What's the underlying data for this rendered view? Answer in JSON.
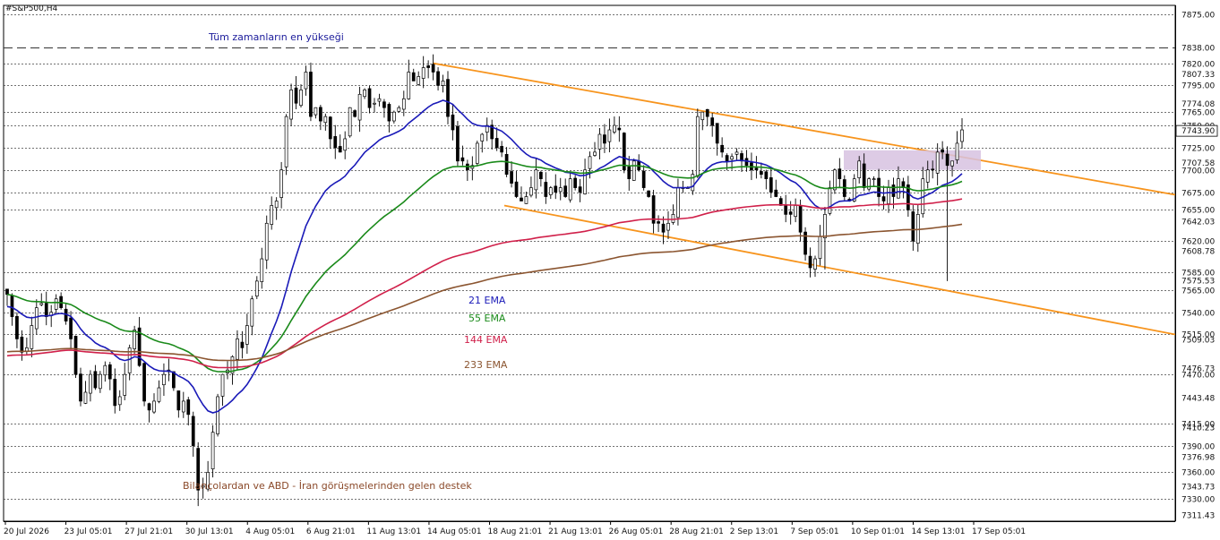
{
  "symbol_label": "#S&P500,H4",
  "chart_data": {
    "type": "candlestick",
    "symbol": "#S&P500,H4",
    "ylim": [
      7305,
      7885
    ],
    "price_levels": [
      7875,
      7838,
      7820,
      7795,
      7765,
      7750,
      7725,
      7700,
      7675,
      7655,
      7620,
      7585,
      7565,
      7540,
      7515,
      7470,
      7415,
      7390,
      7360,
      7330
    ],
    "y_ticks_minor": [
      7807.33,
      7774.08,
      7743.9,
      7707.58,
      7642.03,
      7608.78,
      7575.53,
      7509.03,
      7476.73,
      7443.48,
      7410.23,
      7376.98,
      7343.73,
      7311.43
    ],
    "current_price": "7743.90",
    "all_time_high": 7838,
    "x_ticks": [
      "20 Jul 2026",
      "23 Jul 05:01",
      "27 Jul 21:01",
      "30 Jul 13:01",
      "4 Aug 05:01",
      "6 Aug 21:01",
      "11 Aug 13:01",
      "14 Aug 05:01",
      "18 Aug 21:01",
      "21 Aug 13:01",
      "26 Aug 05:01",
      "28 Aug 21:01",
      "2 Sep 13:01",
      "7 Sep 05:01",
      "10 Sep 01:01",
      "14 Sep 13:01",
      "17 Sep 05:01"
    ],
    "closes": [
      7560,
      7535,
      7510,
      7495,
      7500,
      7525,
      7545,
      7550,
      7535,
      7540,
      7555,
      7545,
      7530,
      7510,
      7470,
      7440,
      7450,
      7470,
      7455,
      7470,
      7480,
      7465,
      7435,
      7445,
      7470,
      7500,
      7520,
      7480,
      7440,
      7430,
      7440,
      7455,
      7470,
      7475,
      7455,
      7430,
      7440,
      7425,
      7390,
      7340,
      7345,
      7360,
      7405,
      7445,
      7470,
      7475,
      7490,
      7510,
      7500,
      7525,
      7555,
      7575,
      7600,
      7640,
      7660,
      7665,
      7700,
      7760,
      7790,
      7775,
      7790,
      7810,
      7760,
      7770,
      7755,
      7760,
      7735,
      7725,
      7720,
      7735,
      7770,
      7760,
      7785,
      7790,
      7770,
      7775,
      7780,
      7770,
      7755,
      7765,
      7770,
      7780,
      7810,
      7800,
      7805,
      7815,
      7815,
      7810,
      7795,
      7800,
      7760,
      7745,
      7710,
      7710,
      7700,
      7705,
      7730,
      7740,
      7750,
      7735,
      7725,
      7720,
      7695,
      7685,
      7670,
      7665,
      7670,
      7680,
      7700,
      7690,
      7670,
      7680,
      7675,
      7680,
      7670,
      7690,
      7680,
      7675,
      7700,
      7715,
      7720,
      7740,
      7730,
      7745,
      7750,
      7745,
      7700,
      7690,
      7710,
      7700,
      7680,
      7670,
      7640,
      7640,
      7630,
      7640,
      7650,
      7680,
      7680,
      7680,
      7695,
      7760,
      7765,
      7760,
      7750,
      7730,
      7720,
      7710,
      7715,
      7720,
      7710,
      7705,
      7700,
      7700,
      7695,
      7690,
      7675,
      7670,
      7660,
      7650,
      7650,
      7660,
      7630,
      7605,
      7590,
      7600,
      7625,
      7650,
      7680,
      7700,
      7690,
      7670,
      7665,
      7690,
      7710,
      7680,
      7690,
      7690,
      7670,
      7665,
      7680,
      7670,
      7690,
      7680,
      7655,
      7620,
      7650,
      7690,
      7700,
      7700,
      7720,
      7720,
      7705,
      7710,
      7730,
      7745
    ],
    "series": [
      {
        "name": "21 EMA",
        "color": "#1a1ab8"
      },
      {
        "name": "55 EMA",
        "color": "#1a8a1a"
      },
      {
        "name": "144 EMA",
        "color": "#d0204a"
      },
      {
        "name": "233 EMA",
        "color": "#8b5530"
      }
    ],
    "channel": {
      "color": "#f7941d",
      "upper": [
        [
          0.0,
          7820
        ],
        [
          1.0,
          7672
        ]
      ],
      "lower": [
        [
          0.0,
          7660
        ],
        [
          1.0,
          7515
        ]
      ]
    },
    "zone": {
      "color": "#d7c2e0",
      "y1": 7700,
      "y2": 7722
    }
  },
  "annotations": {
    "ath": "Tüm zamanların en yükseği",
    "support": "Bilançolardan ve ABD - İran görüşmelerinden gelen destek",
    "ema21": "21 EMA",
    "ema55": "55 EMA",
    "ema144": "144 EMA",
    "ema233": "233 EMA"
  },
  "colors": {
    "ath_text": "#1a1a9a",
    "support_text": "#8b4a2a",
    "up_candle": "#ffffff",
    "down_candle": "#000000"
  }
}
